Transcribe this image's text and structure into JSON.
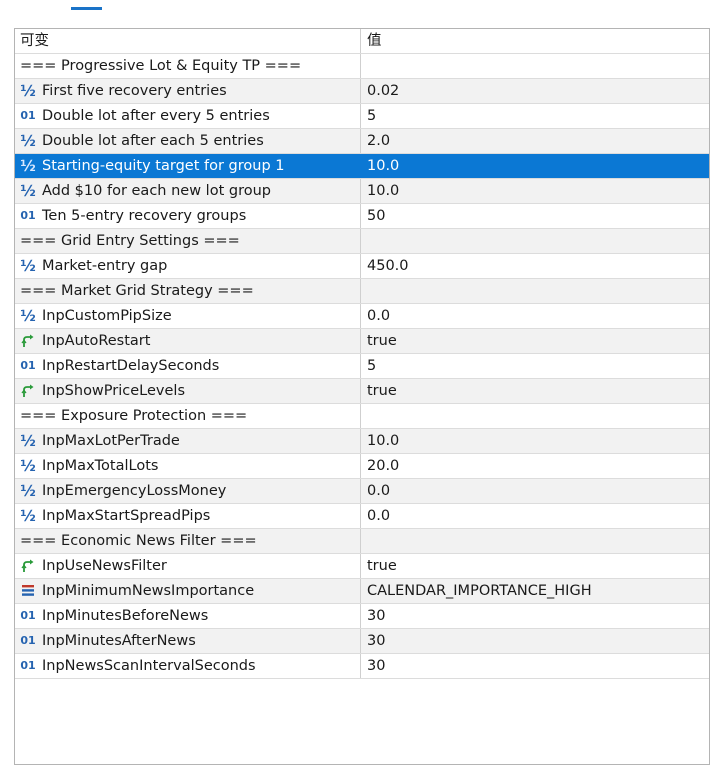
{
  "header": {
    "col_variable": "可变",
    "col_value": "值"
  },
  "rows": [
    {
      "type": "section",
      "name": "=== Progressive Lot & Equity TP ===",
      "value": ""
    },
    {
      "type": "double",
      "icon": "½",
      "name": "First five recovery entries",
      "value": "0.02"
    },
    {
      "type": "int",
      "icon": "01",
      "name": "Double lot after every 5 entries",
      "value": "5"
    },
    {
      "type": "double",
      "icon": "½",
      "name": "Double lot after each 5 entries",
      "value": "2.0"
    },
    {
      "type": "double",
      "icon": "½",
      "name": "Starting-equity target for group 1",
      "value": "10.0",
      "selected": true
    },
    {
      "type": "double",
      "icon": "½",
      "name": "Add $10 for each new lot group",
      "value": "10.0"
    },
    {
      "type": "int",
      "icon": "01",
      "name": "Ten 5-entry recovery groups",
      "value": "50"
    },
    {
      "type": "section",
      "name": "=== Grid Entry Settings ===",
      "value": ""
    },
    {
      "type": "double",
      "icon": "½",
      "name": "Market-entry gap",
      "value": "450.0"
    },
    {
      "type": "section",
      "name": "=== Market Grid Strategy ===",
      "value": ""
    },
    {
      "type": "double",
      "icon": "½",
      "name": "InpCustomPipSize",
      "value": "0.0"
    },
    {
      "type": "bool",
      "name": "InpAutoRestart",
      "value": "true"
    },
    {
      "type": "int",
      "icon": "01",
      "name": "InpRestartDelaySeconds",
      "value": "5"
    },
    {
      "type": "bool",
      "name": "InpShowPriceLevels",
      "value": "true"
    },
    {
      "type": "section",
      "name": "=== Exposure Protection ===",
      "value": ""
    },
    {
      "type": "double",
      "icon": "½",
      "name": "InpMaxLotPerTrade",
      "value": "10.0"
    },
    {
      "type": "double",
      "icon": "½",
      "name": "InpMaxTotalLots",
      "value": "20.0"
    },
    {
      "type": "double",
      "icon": "½",
      "name": "InpEmergencyLossMoney",
      "value": "0.0"
    },
    {
      "type": "double",
      "icon": "½",
      "name": "InpMaxStartSpreadPips",
      "value": "0.0"
    },
    {
      "type": "section",
      "name": "=== Economic News Filter ===",
      "value": ""
    },
    {
      "type": "bool",
      "name": "InpUseNewsFilter",
      "value": "true"
    },
    {
      "type": "enum",
      "name": "InpMinimumNewsImportance",
      "value": "CALENDAR_IMPORTANCE_HIGH"
    },
    {
      "type": "int",
      "icon": "01",
      "name": "InpMinutesBeforeNews",
      "value": "30"
    },
    {
      "type": "int",
      "icon": "01",
      "name": "InpMinutesAfterNews",
      "value": "30"
    },
    {
      "type": "int",
      "icon": "01",
      "name": "InpNewsScanIntervalSeconds",
      "value": "30"
    }
  ],
  "colors": {
    "selected_bg": "#0b78d4",
    "alt_bg": "#f2f2f2",
    "tab_indicator": "#1a73c8"
  }
}
